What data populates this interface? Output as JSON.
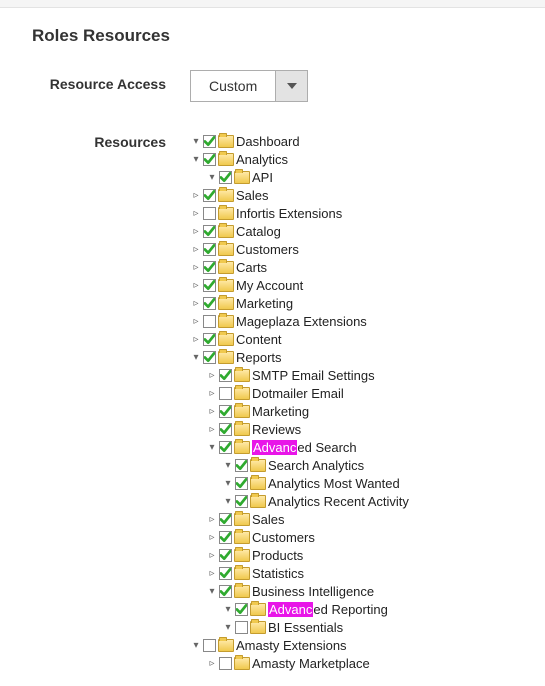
{
  "section_title": "Roles Resources",
  "resource_access_label": "Resource Access",
  "resource_access_value": "Custom",
  "resources_label": "Resources",
  "highlight": "Advanc",
  "tree": [
    {
      "label": "Dashboard",
      "checked": true,
      "state": "expanded",
      "children": []
    },
    {
      "label": "Analytics",
      "checked": true,
      "state": "expanded",
      "children": [
        {
          "label": "API",
          "checked": true,
          "state": "expanded",
          "children": []
        }
      ]
    },
    {
      "label": "Sales",
      "checked": true,
      "state": "collapsed",
      "children": []
    },
    {
      "label": "Infortis Extensions",
      "checked": false,
      "state": "collapsed",
      "children": []
    },
    {
      "label": "Catalog",
      "checked": true,
      "state": "collapsed",
      "children": []
    },
    {
      "label": "Customers",
      "checked": true,
      "state": "collapsed",
      "children": []
    },
    {
      "label": "Carts",
      "checked": true,
      "state": "collapsed",
      "children": []
    },
    {
      "label": "My Account",
      "checked": true,
      "state": "collapsed",
      "children": []
    },
    {
      "label": "Marketing",
      "checked": true,
      "state": "collapsed",
      "children": []
    },
    {
      "label": "Mageplaza Extensions",
      "checked": false,
      "state": "collapsed",
      "children": []
    },
    {
      "label": "Content",
      "checked": true,
      "state": "collapsed",
      "children": []
    },
    {
      "label": "Reports",
      "checked": true,
      "state": "expanded",
      "children": [
        {
          "label": "SMTP Email Settings",
          "checked": true,
          "state": "collapsed",
          "children": []
        },
        {
          "label": "Dotmailer Email",
          "checked": false,
          "state": "collapsed",
          "children": []
        },
        {
          "label": "Marketing",
          "checked": true,
          "state": "collapsed",
          "children": []
        },
        {
          "label": "Reviews",
          "checked": true,
          "state": "collapsed",
          "children": []
        },
        {
          "label": "Advanced Search",
          "checked": true,
          "state": "expanded",
          "children": [
            {
              "label": "Search Analytics",
              "checked": true,
              "state": "expanded",
              "children": []
            },
            {
              "label": "Analytics Most Wanted",
              "checked": true,
              "state": "expanded",
              "children": []
            },
            {
              "label": "Analytics Recent Activity",
              "checked": true,
              "state": "expanded",
              "children": []
            }
          ]
        },
        {
          "label": "Sales",
          "checked": true,
          "state": "collapsed",
          "children": []
        },
        {
          "label": "Customers",
          "checked": true,
          "state": "collapsed",
          "children": []
        },
        {
          "label": "Products",
          "checked": true,
          "state": "collapsed",
          "children": []
        },
        {
          "label": "Statistics",
          "checked": true,
          "state": "collapsed",
          "children": []
        },
        {
          "label": "Business Intelligence",
          "checked": true,
          "state": "expanded",
          "children": [
            {
              "label": "Advanced Reporting",
              "checked": true,
              "state": "expanded",
              "children": []
            },
            {
              "label": "BI Essentials",
              "checked": false,
              "state": "expanded",
              "children": []
            }
          ]
        }
      ]
    },
    {
      "label": "Amasty Extensions",
      "checked": false,
      "state": "expanded",
      "children": [
        {
          "label": "Amasty Marketplace",
          "checked": false,
          "state": "collapsed",
          "children": []
        }
      ]
    }
  ]
}
